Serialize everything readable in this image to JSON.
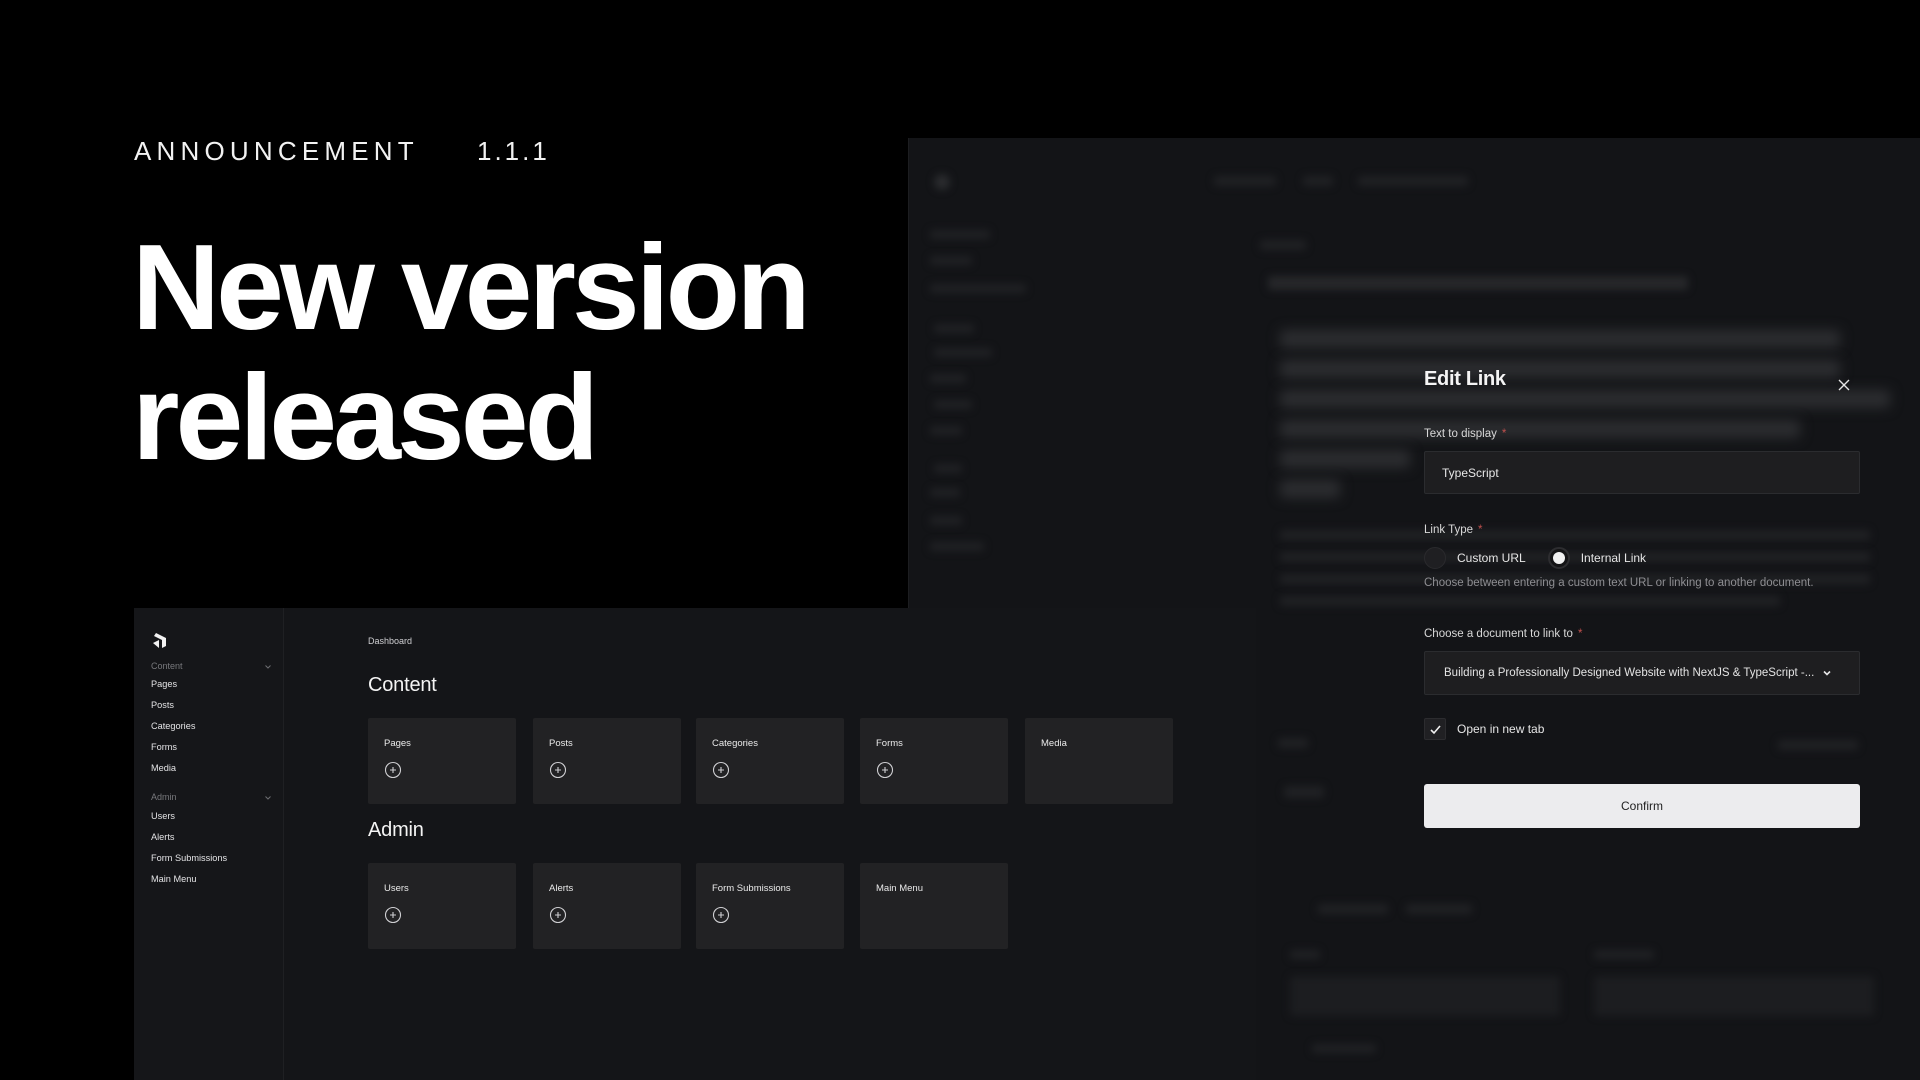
{
  "hero": {
    "eyebrow": "ANNOUNCEMENT",
    "version": "1.1.1",
    "headline_line1": "New version",
    "headline_line2": "released"
  },
  "modal": {
    "title": "Edit Link",
    "close_icon": "close-icon",
    "text_to_display": {
      "label": "Text to display",
      "required": "*",
      "value": "TypeScript"
    },
    "link_type": {
      "label": "Link Type",
      "required": "*",
      "options": [
        {
          "label": "Custom URL",
          "selected": false
        },
        {
          "label": "Internal Link",
          "selected": true
        }
      ],
      "helper": "Choose between entering a custom text URL or linking to another document."
    },
    "document": {
      "label": "Choose a document to link to",
      "required": "*",
      "value": "Building a Professionally Designed Website with NextJS & TypeScript -..."
    },
    "open_in_new_tab": {
      "label": "Open in new tab",
      "checked": true
    },
    "confirm_label": "Confirm"
  },
  "dashboard": {
    "logo": "payload-logo-icon",
    "breadcrumb": "Dashboard",
    "sidebar": {
      "groups": [
        {
          "label": "Content",
          "items": [
            "Pages",
            "Posts",
            "Categories",
            "Forms",
            "Media"
          ]
        },
        {
          "label": "Admin",
          "items": [
            "Users",
            "Alerts",
            "Form Submissions",
            "Main Menu"
          ]
        }
      ]
    },
    "sections": [
      {
        "title": "Content",
        "cards": [
          {
            "label": "Pages",
            "has_add": true
          },
          {
            "label": "Posts",
            "has_add": true
          },
          {
            "label": "Categories",
            "has_add": true
          },
          {
            "label": "Forms",
            "has_add": true
          },
          {
            "label": "Media",
            "has_add": false
          }
        ]
      },
      {
        "title": "Admin",
        "cards": [
          {
            "label": "Users",
            "has_add": true
          },
          {
            "label": "Alerts",
            "has_add": true
          },
          {
            "label": "Form Submissions",
            "has_add": true
          },
          {
            "label": "Main Menu",
            "has_add": false
          }
        ]
      }
    ]
  },
  "colors": {
    "page_bg": "#000000",
    "panel_bg": "#141518",
    "card_bg": "#222224",
    "required": "#c0504d",
    "confirm_bg": "#ececee"
  }
}
